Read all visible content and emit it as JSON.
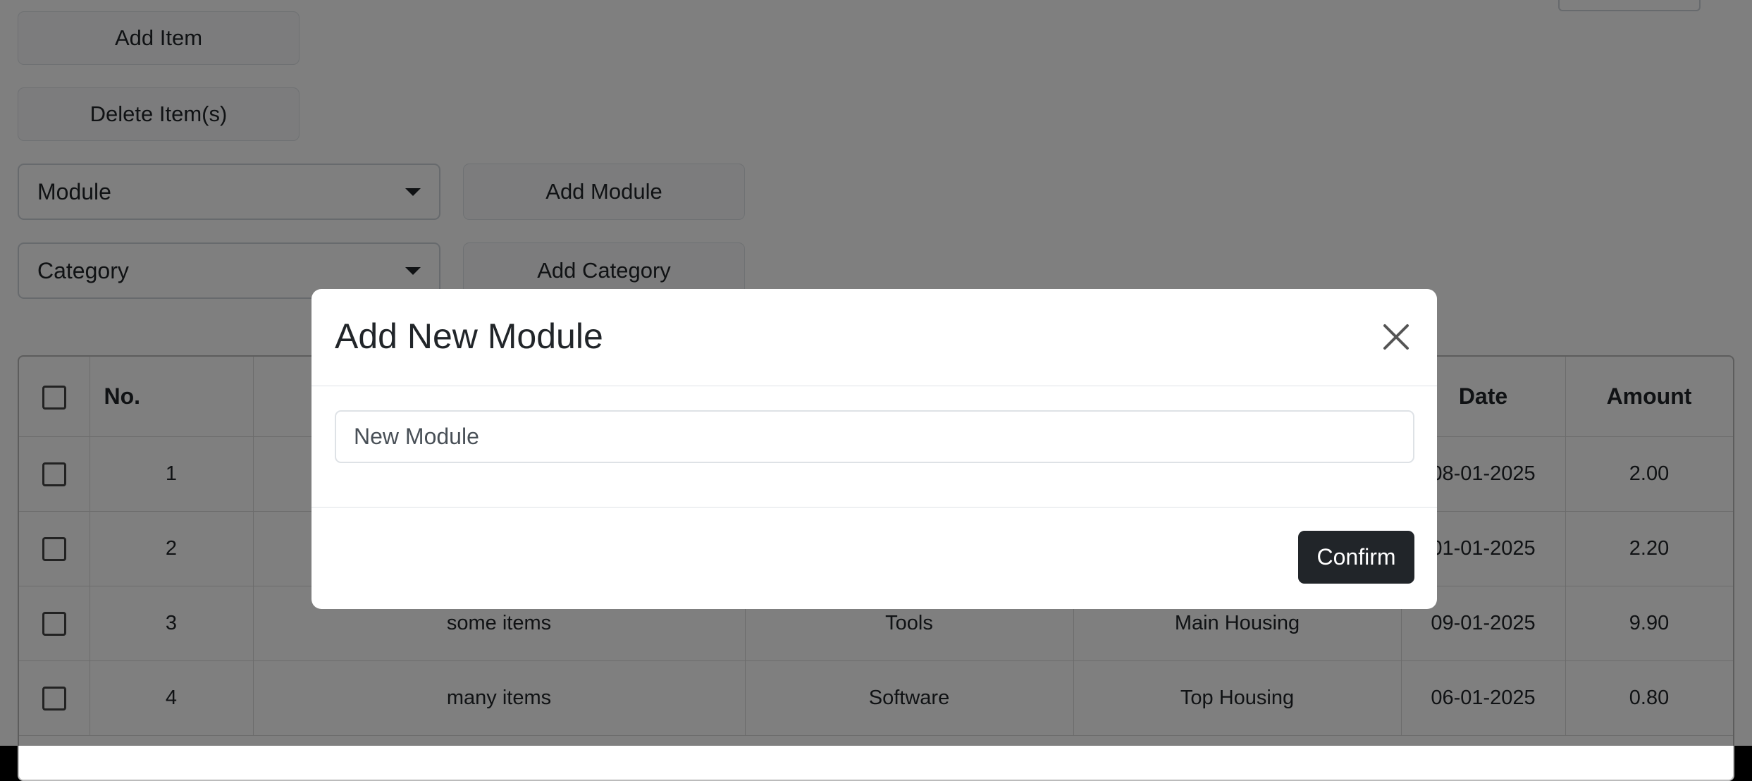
{
  "toolbar": {
    "add_item_label": "Add Item",
    "delete_items_label": "Delete Item(s)",
    "add_module_label": "Add Module",
    "add_category_label": "Add Category",
    "module_select_value": "Module",
    "category_select_value": "Category"
  },
  "table": {
    "headers": {
      "no": "No.",
      "date": "Date",
      "amount": "Amount"
    },
    "rows": [
      {
        "no": "1",
        "name": "",
        "category": "",
        "module": "",
        "date": "08-01-2025",
        "amount": "2.00"
      },
      {
        "no": "2",
        "name": "",
        "category": "",
        "module": "",
        "date": "01-01-2025",
        "amount": "2.20"
      },
      {
        "no": "3",
        "name": "some items",
        "category": "Tools",
        "module": "Main Housing",
        "date": "09-01-2025",
        "amount": "9.90"
      },
      {
        "no": "4",
        "name": "many items",
        "category": "Software",
        "module": "Top Housing",
        "date": "06-01-2025",
        "amount": "0.80"
      }
    ]
  },
  "modal": {
    "title": "Add New Module",
    "input_value": "New Module",
    "confirm_label": "Confirm",
    "close_icon": "close-icon"
  },
  "colors": {
    "backdrop": "#000000",
    "confirm_bg": "#212529",
    "button_bg": "#f8f9fa"
  }
}
